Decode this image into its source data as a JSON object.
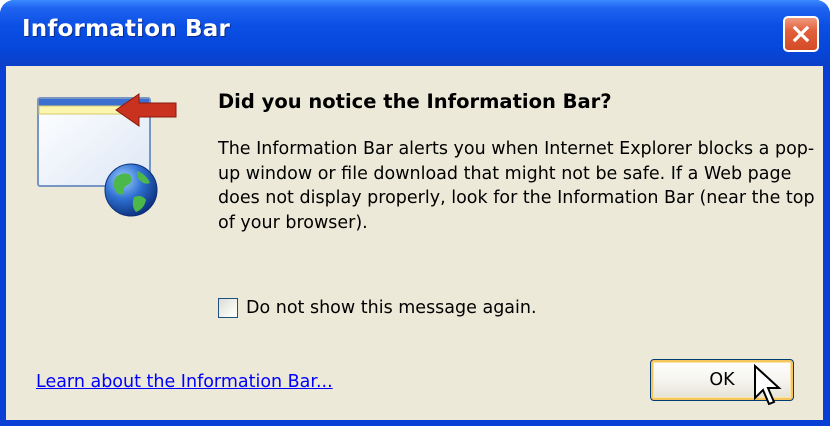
{
  "window": {
    "title": "Information Bar",
    "close_icon": "close-x-icon"
  },
  "illustration": {
    "icon": "information-bar-browser-globe-icon",
    "arrow_icon": "red-arrow-left-icon"
  },
  "content": {
    "heading": "Did you notice the Information Bar?",
    "body": "The Information Bar alerts you when Internet Explorer blocks a pop-up window or file download that might not be safe. If a Web page does not display properly, look for the Information Bar (near the top of your browser)."
  },
  "checkbox": {
    "label": "Do not show this message again.",
    "checked": false
  },
  "footer": {
    "link_text": "Learn about the Information Bar...",
    "ok_label": "OK"
  },
  "colors": {
    "titlebar": "#0746DA",
    "client_bg": "#ECE9D8",
    "close_button": "#E2603D",
    "link": "#0000FF"
  }
}
